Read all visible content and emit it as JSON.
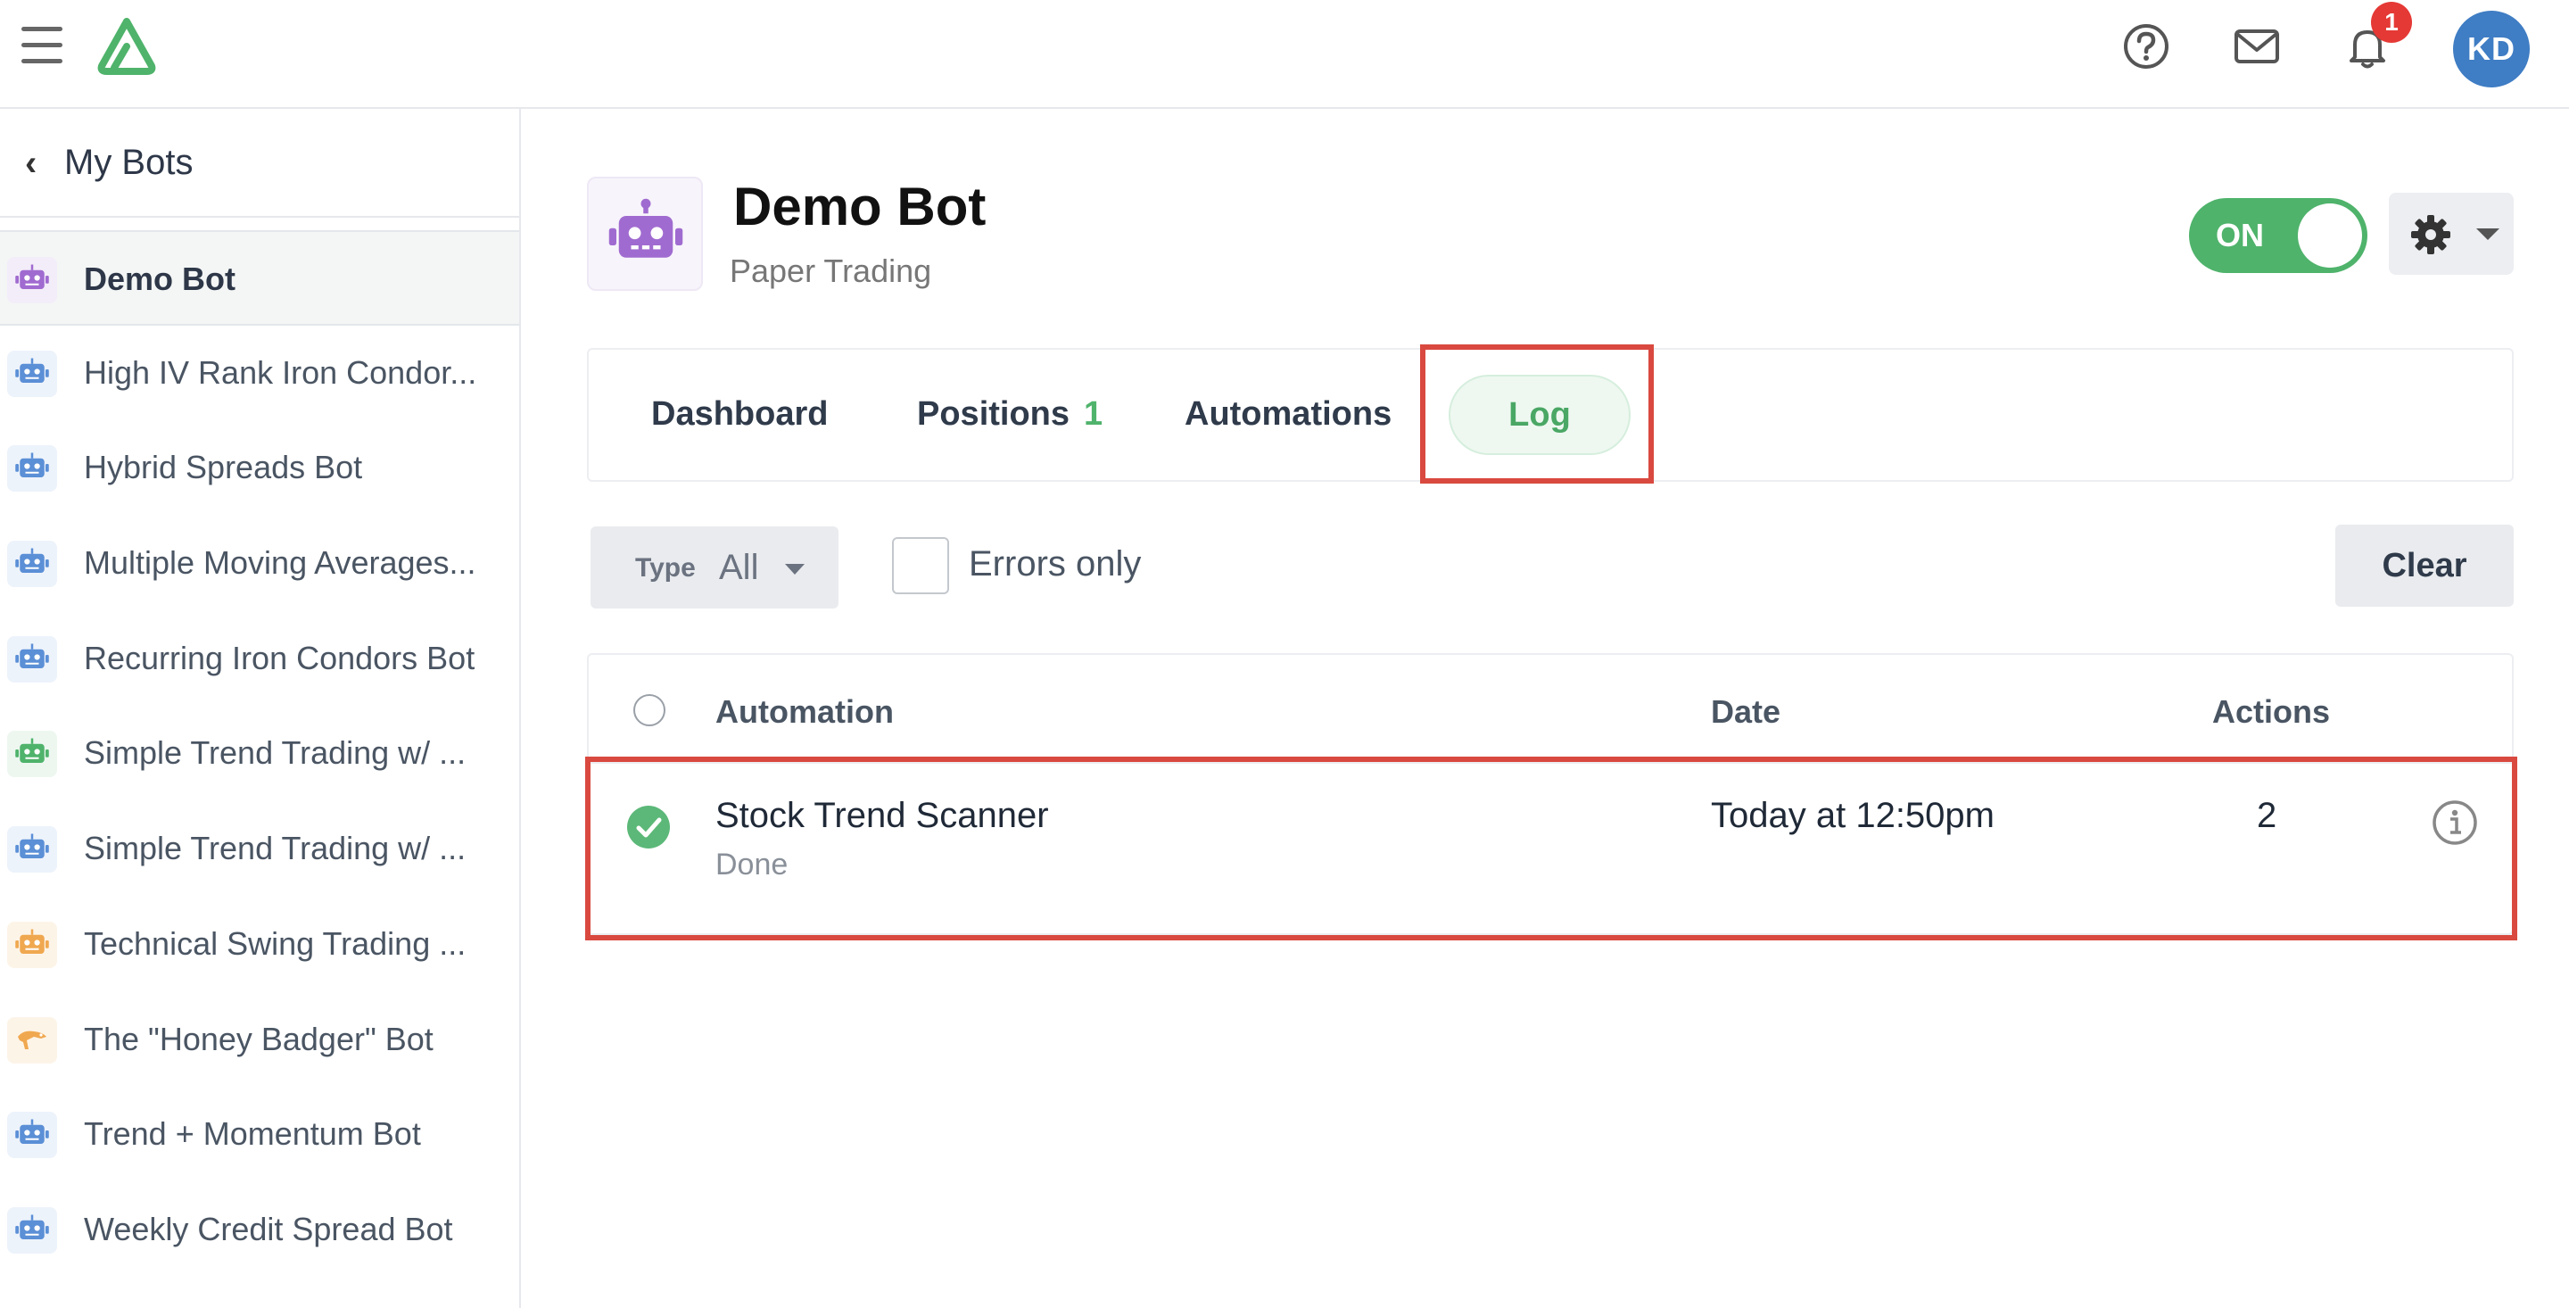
{
  "colors": {
    "brand_green": "#4fb36b",
    "highlight_red": "#d9493f",
    "avatar_blue": "#3f7dc4",
    "badge_red": "#e53935"
  },
  "topbar": {
    "menu_icon": "hamburger-icon",
    "logo_icon": "brand-logo",
    "help_icon": "question-circle-icon",
    "mail_icon": "envelope-icon",
    "bell_icon": "bell-icon",
    "notification_count": "1",
    "avatar_initials": "KD"
  },
  "sidebar": {
    "back_label": "My Bots",
    "items": [
      {
        "label": "Demo Bot",
        "icon_color": "#a06bd0",
        "bg": "#f3edf9",
        "active": true
      },
      {
        "label": "High IV Rank Iron Condor...",
        "icon_color": "#5b8fd6",
        "bg": "#edf3fb"
      },
      {
        "label": "Hybrid Spreads Bot",
        "icon_color": "#5b8fd6",
        "bg": "#edf3fb"
      },
      {
        "label": "Multiple Moving Averages...",
        "icon_color": "#5b8fd6",
        "bg": "#edf3fb"
      },
      {
        "label": "Recurring Iron Condors Bot",
        "icon_color": "#5b8fd6",
        "bg": "#edf3fb"
      },
      {
        "label": "Simple Trend Trading w/ ...",
        "icon_color": "#4fb36b",
        "bg": "#edf7f0"
      },
      {
        "label": "Simple Trend Trading w/ ...",
        "icon_color": "#5b8fd6",
        "bg": "#edf3fb"
      },
      {
        "label": "Technical Swing Trading ...",
        "icon_color": "#f0a850",
        "bg": "#fdf4e8"
      },
      {
        "label": "The \"Honey Badger\" Bot",
        "icon_color": "#f0a850",
        "bg": "#fdf4e8",
        "icon": "badger-icon"
      },
      {
        "label": "Trend + Momentum Bot",
        "icon_color": "#5b8fd6",
        "bg": "#edf3fb"
      },
      {
        "label": "Weekly Credit Spread Bot",
        "icon_color": "#5b8fd6",
        "bg": "#edf3fb"
      }
    ]
  },
  "header": {
    "title": "Demo Bot",
    "subtitle": "Paper Trading",
    "toggle_label": "ON",
    "toggle_on": true
  },
  "tabs": {
    "dashboard": "Dashboard",
    "positions": "Positions",
    "positions_count": "1",
    "automations": "Automations",
    "log": "Log",
    "active": "Log"
  },
  "filters": {
    "type_label": "Type",
    "type_value": "All",
    "errors_only_label": "Errors only",
    "errors_only_checked": false,
    "clear_label": "Clear"
  },
  "table": {
    "columns": [
      "Automation",
      "Date",
      "Actions"
    ],
    "rows": [
      {
        "automation": "Stock Trend Scanner",
        "status": "Done",
        "date": "Today at 12:50pm",
        "actions": "2",
        "status_icon": "check-circle-icon"
      }
    ]
  }
}
